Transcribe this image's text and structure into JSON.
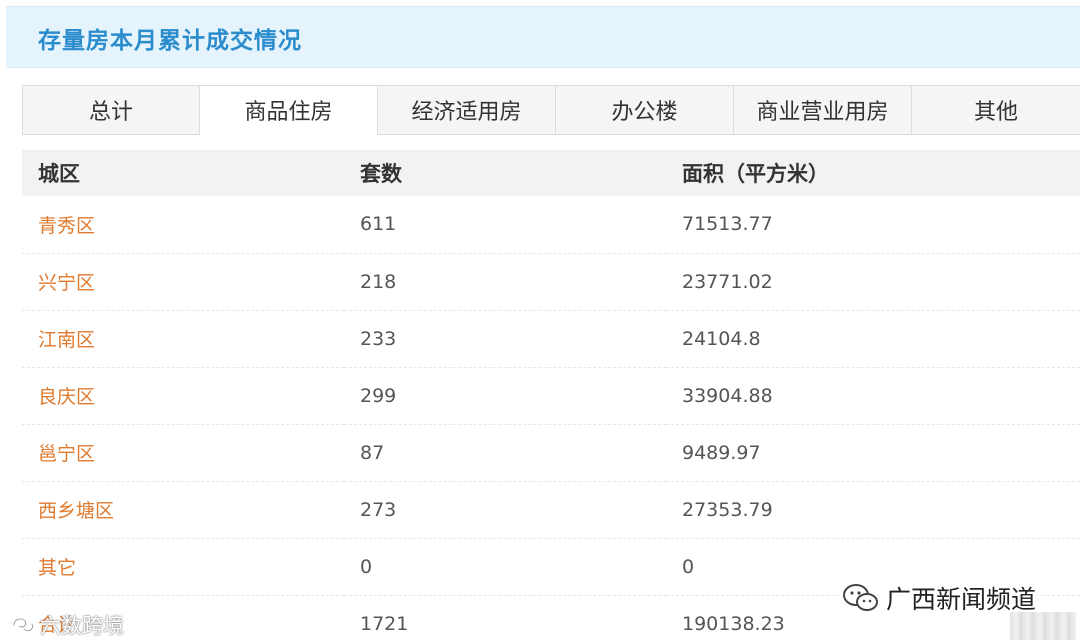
{
  "header": {
    "title": "存量房本月累计成交情况"
  },
  "tabs": [
    {
      "label": "总计",
      "active": false
    },
    {
      "label": "商品住房",
      "active": true
    },
    {
      "label": "经济适用房",
      "active": false
    },
    {
      "label": "办公楼",
      "active": false
    },
    {
      "label": "商业营业用房",
      "active": false
    },
    {
      "label": "其他",
      "active": false
    }
  ],
  "table": {
    "columns": [
      "城区",
      "套数",
      "面积（平方米）"
    ],
    "rows": [
      {
        "district": "青秀区",
        "units": "611",
        "area": "71513.77"
      },
      {
        "district": "兴宁区",
        "units": "218",
        "area": "23771.02"
      },
      {
        "district": "江南区",
        "units": "233",
        "area": "24104.8"
      },
      {
        "district": "良庆区",
        "units": "299",
        "area": "33904.88"
      },
      {
        "district": "邕宁区",
        "units": "87",
        "area": "9489.97"
      },
      {
        "district": "西乡塘区",
        "units": "273",
        "area": "27353.79"
      },
      {
        "district": "其它",
        "units": "0",
        "area": "0"
      },
      {
        "district": "合计",
        "units": "1721",
        "area": "190138.23"
      }
    ]
  },
  "watermarks": {
    "left": "六数跨境",
    "right": "广西新闻频道"
  },
  "colors": {
    "header_bg": "#e4f3fc",
    "title": "#2a8ccc",
    "district": "#e07a2e",
    "text": "#555555"
  }
}
